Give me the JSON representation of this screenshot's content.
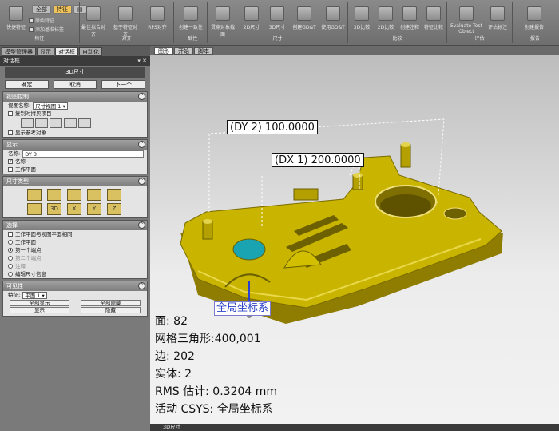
{
  "ribbon": {
    "tabs": [
      "全部",
      "特征",
      "▤"
    ],
    "left_options": [
      "原始特征",
      "添加基准标签"
    ],
    "groups": [
      {
        "label": "特征",
        "buttons": [
          "快捷特征"
        ]
      },
      {
        "label": "对齐",
        "buttons": [
          "最佳拟合对齐",
          "基于特征对齐",
          "RPS对齐"
        ]
      },
      {
        "label": "一致性",
        "buttons": [
          "创建一致性"
        ]
      },
      {
        "label": "尺寸",
        "buttons": [
          "贯穿对象截面",
          "2D尺寸",
          "3D尺寸",
          "创建GD&T",
          "使用GD&T"
        ]
      },
      {
        "label": "比较",
        "buttons": [
          "3D比较",
          "2D比较",
          "创建注释",
          "特征比较"
        ]
      },
      {
        "label": "评估",
        "buttons": [
          "Evaluate Test Object",
          "评估标注"
        ]
      },
      {
        "label": "报告",
        "buttons": [
          "创建报告"
        ]
      }
    ]
  },
  "panel": {
    "tabs": [
      "模型管理器",
      "显示",
      "对话框",
      "自动化"
    ],
    "dialog_title": "对话框",
    "dialog_controls": "▾ ✕",
    "header": "3D尺寸",
    "buttons": {
      "ok": "确定",
      "cancel": "取消",
      "next": "下一个"
    },
    "view_control": {
      "title": "视图控制",
      "view_name_label": "视图名称:",
      "view_name_value": "尺寸视图 1",
      "copy_view_items": "复制时拷贝项目",
      "show_reference": "显示参考对象"
    },
    "display": {
      "title": "显示",
      "name_label": "名称:",
      "name_value": "DY 3",
      "name_check": "名称",
      "workplane_check": "工作平面"
    },
    "dim_type": {
      "title": "尺寸类型",
      "row2": [
        "",
        "3D",
        "X",
        "Y",
        "Z"
      ]
    },
    "select": {
      "title": "选择",
      "same_plane": "工作平面与视图平面相同",
      "options": [
        "工作平面",
        "第一个端点",
        "第二个端点",
        "注释",
        "编辑尺寸信息"
      ]
    },
    "visibility": {
      "title": "可见性",
      "feature_label": "特征:",
      "feature_value": "平面 1",
      "show_all": "全部显示",
      "hide_all": "全部隐藏",
      "show": "显示",
      "hide": "隐藏"
    }
  },
  "viewport": {
    "tabs": [
      "图形",
      "开始",
      "脚本"
    ],
    "callouts": {
      "dy2": "(DY 2) 100.0000",
      "dx1": "(DX 1) 200.0000"
    },
    "csys_label": "全局坐标系",
    "stats": {
      "faces": "面: 82",
      "mesh_triangles": "网格三角形:400,001",
      "edges": "边: 202",
      "bodies": "实体: 2",
      "rms": "RMS 估计:  0.3204 mm",
      "active_csys": "活动 CSYS:  全局坐标系"
    },
    "status_text": "3D尺寸"
  },
  "colors": {
    "part": "#c9b400",
    "part_dark": "#8e7d00",
    "hole": "#1aa3b0",
    "accent_tab": "#f0c25a"
  }
}
